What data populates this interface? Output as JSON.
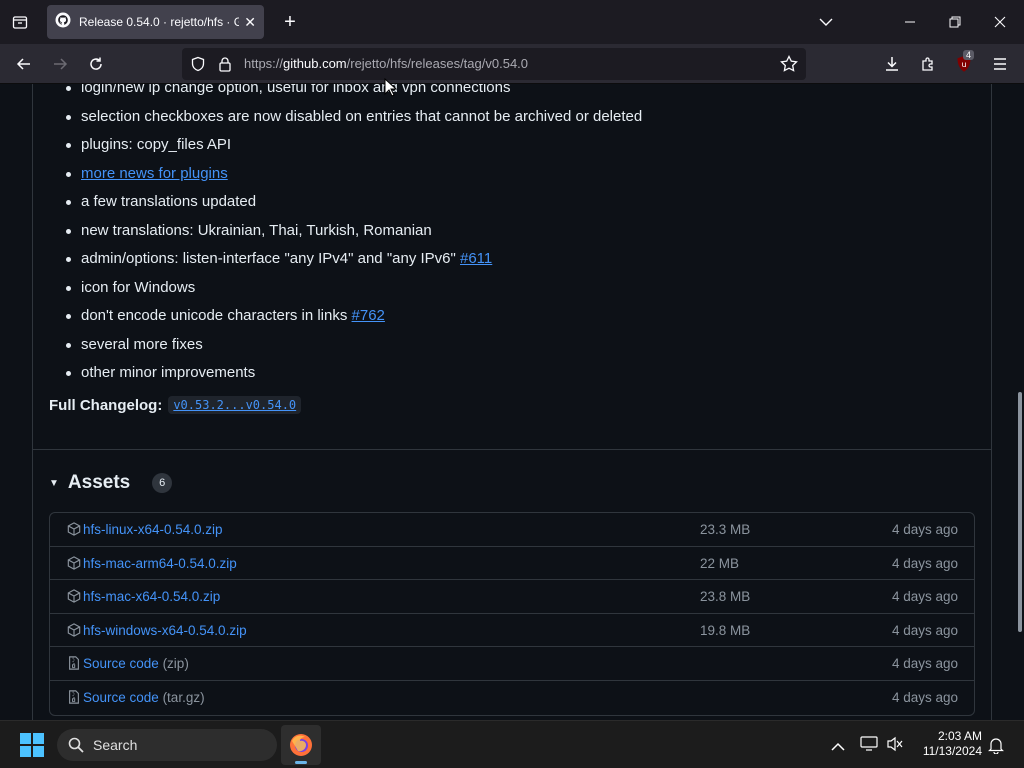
{
  "browser": {
    "tab_title": "Release 0.54.0 · rejetto/hfs · GitHub",
    "url_prefix": "https://",
    "url_host": "github.com",
    "url_path": "/rejetto/hfs/releases/tag/v0.54.0",
    "extension_badge": "4"
  },
  "notes": {
    "partial_top": "login/new ip change option, useful for inbox and vpn connections",
    "items": [
      "selection checkboxes are now disabled on entries that cannot be archived or deleted",
      "plugins: copy_files API",
      "more news for plugins",
      "a few translations updated",
      "new translations: Ukrainian, Thai, Turkish, Romanian",
      "admin/options: listen-interface \"any IPv4\" and \"any IPv6\" ",
      "icon for Windows",
      "don't encode unicode characters in links ",
      "several more fixes",
      "other minor improvements"
    ],
    "link_611": "#611",
    "link_762": "#762"
  },
  "changelog": {
    "label": "Full Changelog",
    "colon": ":",
    "range": "v0.53.2...v0.54.0"
  },
  "assets": {
    "title": "Assets",
    "count": "6",
    "rows": [
      {
        "name": "hfs-linux-x64-0.54.0.zip",
        "ext": "",
        "size": "23.3 MB",
        "date": "4 days ago",
        "icon": "package-icon"
      },
      {
        "name": "hfs-mac-arm64-0.54.0.zip",
        "ext": "",
        "size": "22 MB",
        "date": "4 days ago",
        "icon": "package-icon"
      },
      {
        "name": "hfs-mac-x64-0.54.0.zip",
        "ext": "",
        "size": "23.8 MB",
        "date": "4 days ago",
        "icon": "package-icon"
      },
      {
        "name": "hfs-windows-x64-0.54.0.zip",
        "ext": "",
        "size": "19.8 MB",
        "date": "4 days ago",
        "icon": "package-icon"
      },
      {
        "name": "Source code",
        "ext": " (zip)",
        "size": "",
        "date": "4 days ago",
        "icon": "file-zip-icon"
      },
      {
        "name": "Source code",
        "ext": " (tar.gz)",
        "size": "",
        "date": "4 days ago",
        "icon": "file-zip-icon"
      }
    ]
  },
  "taskbar": {
    "search_label": "Search",
    "time": "2:03 AM",
    "date": "11/13/2024"
  }
}
